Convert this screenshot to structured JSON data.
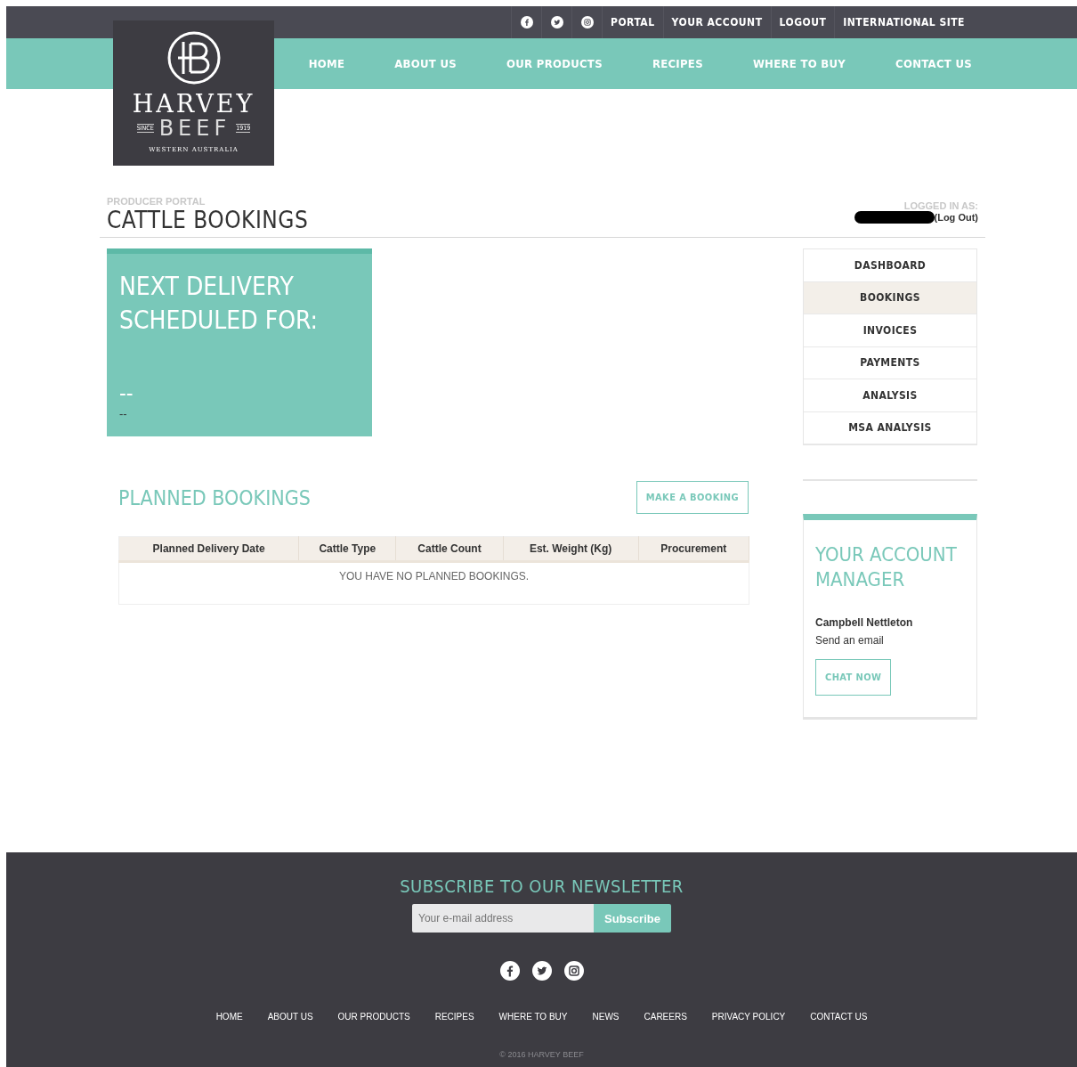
{
  "top_bar": {
    "social": [
      {
        "kind": "facebook"
      },
      {
        "kind": "twitter"
      },
      {
        "kind": "instagram"
      }
    ],
    "links": [
      "PORTAL",
      "YOUR ACCOUNT",
      "LOGOUT",
      "INTERNATIONAL SITE"
    ]
  },
  "logo": {
    "name_line_1": "HARVEY",
    "name_line_2": "BEEF",
    "since_label": "SINCE",
    "since_year": "1919",
    "region": "WESTERN AUSTRALIA"
  },
  "main_nav": [
    "HOME",
    "ABOUT US",
    "OUR PRODUCTS",
    "RECIPES",
    "WHERE TO BUY",
    "CONTACT US"
  ],
  "page_header": {
    "eyebrow": "PRODUCER PORTAL",
    "title": "CATTLE BOOKINGS",
    "logged_in_label": "LOGGED IN AS:",
    "logout_link": "(Log Out)"
  },
  "next_delivery": {
    "title": "NEXT DELIVERY SCHEDULED FOR:",
    "date": "--",
    "detail": "--"
  },
  "side_menu": [
    {
      "label": "DASHBOARD",
      "selected": false
    },
    {
      "label": "BOOKINGS",
      "selected": true
    },
    {
      "label": "INVOICES",
      "selected": false
    },
    {
      "label": "PAYMENTS",
      "selected": false
    },
    {
      "label": "ANALYSIS",
      "selected": false
    },
    {
      "label": "MSA ANALYSIS",
      "selected": false
    }
  ],
  "planned_bookings": {
    "title": "PLANNED BOOKINGS",
    "button": "MAKE A BOOKING",
    "table": {
      "columns": [
        "Planned Delivery Date",
        "Cattle Type",
        "Cattle Count",
        "Est. Weight (Kg)",
        "Procurement"
      ],
      "empty_message": "YOU HAVE NO PLANNED BOOKINGS."
    }
  },
  "account_manager": {
    "title": "YOUR ACCOUNT MANAGER",
    "name": "Campbell Nettleton",
    "email_link": "Send an email",
    "button": "CHAT NOW"
  },
  "footer": {
    "newsletter_title": "SUBSCRIBE TO OUR NEWSLETTER",
    "email_placeholder": "Your e-mail address",
    "subscribe_button": "Subscribe",
    "social": [
      {
        "kind": "facebook"
      },
      {
        "kind": "twitter"
      },
      {
        "kind": "instagram"
      }
    ],
    "links": [
      "HOME",
      "ABOUT US",
      "OUR PRODUCTS",
      "RECIPES",
      "WHERE TO BUY",
      "NEWS",
      "CAREERS",
      "PRIVACY POLICY",
      "CONTACT US"
    ],
    "copyright": "© 2016 HARVEY BEEF"
  }
}
